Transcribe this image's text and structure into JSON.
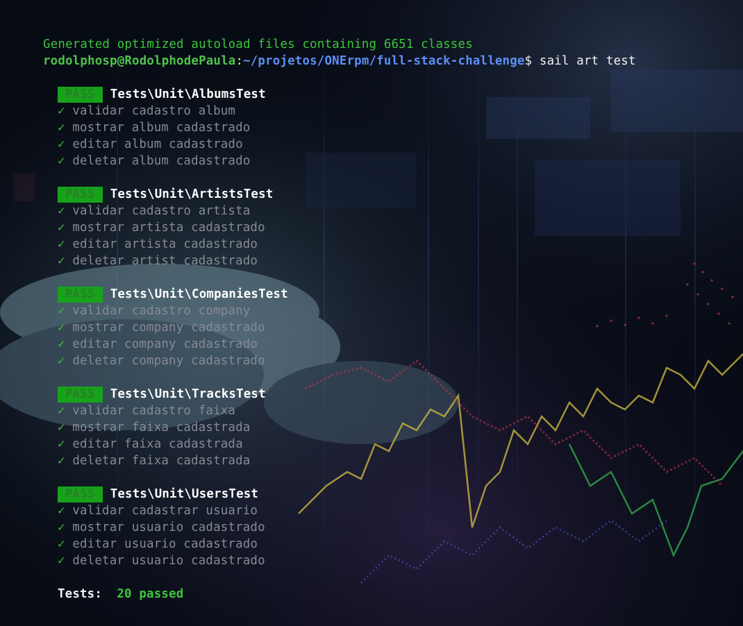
{
  "terminal": {
    "autoload_message": "Generated optimized autoload files containing 6651 classes",
    "prompt": {
      "user_host": "rodolphosp@RodolphodePaula",
      "separator": ":",
      "path": "~/projetos/ONErpm/full-stack-challenge",
      "symbol": "$",
      "command": "sail art test"
    },
    "suites": [
      {
        "status": "PASS",
        "name": "Tests\\Unit\\AlbumsTest",
        "tests": [
          {
            "mark": "✓",
            "name": "validar cadastro album"
          },
          {
            "mark": "✓",
            "name": "mostrar album cadastrado"
          },
          {
            "mark": "✓",
            "name": "editar album cadastrado"
          },
          {
            "mark": "✓",
            "name": "deletar album cadastrado"
          }
        ]
      },
      {
        "status": "PASS",
        "name": "Tests\\Unit\\ArtistsTest",
        "tests": [
          {
            "mark": "✓",
            "name": "validar cadastro artista"
          },
          {
            "mark": "✓",
            "name": "mostrar artista cadastrado"
          },
          {
            "mark": "✓",
            "name": "editar artista cadastrado"
          },
          {
            "mark": "✓",
            "name": "deletar artist cadastrado"
          }
        ]
      },
      {
        "status": "PASS",
        "name": "Tests\\Unit\\CompaniesTest",
        "tests": [
          {
            "mark": "✓",
            "name": "validar cadastro company"
          },
          {
            "mark": "✓",
            "name": "mostrar company cadastrado"
          },
          {
            "mark": "✓",
            "name": "editar company cadastrado"
          },
          {
            "mark": "✓",
            "name": "deletar company cadastrado"
          }
        ]
      },
      {
        "status": "PASS",
        "name": "Tests\\Unit\\TracksTest",
        "tests": [
          {
            "mark": "✓",
            "name": "validar cadastro faixa"
          },
          {
            "mark": "✓",
            "name": "mostrar faixa cadastrada"
          },
          {
            "mark": "✓",
            "name": "editar faixa cadastrada"
          },
          {
            "mark": "✓",
            "name": "deletar faixa cadastrada"
          }
        ]
      },
      {
        "status": "PASS",
        "name": "Tests\\Unit\\UsersTest",
        "tests": [
          {
            "mark": "✓",
            "name": "validar cadastrar usuario"
          },
          {
            "mark": "✓",
            "name": "mostrar usuario cadastrado"
          },
          {
            "mark": "✓",
            "name": "editar usuario cadastrado"
          },
          {
            "mark": "✓",
            "name": "deletar usuario cadastrado"
          }
        ]
      }
    ],
    "summary": {
      "label": "Tests:",
      "value": "20 passed"
    }
  },
  "colors": {
    "background": "#070b14",
    "pass_badge": "#16a31a",
    "success_text": "#3cc73a",
    "path": "#5b8ff5",
    "test_name": "#858b95"
  }
}
